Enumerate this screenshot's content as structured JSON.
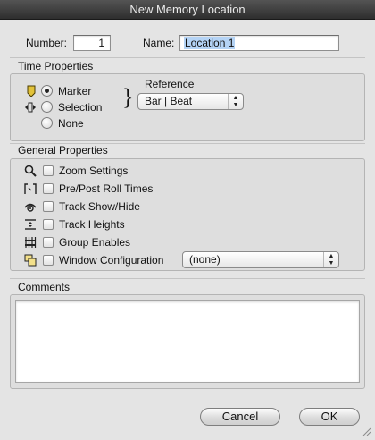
{
  "window": {
    "title": "New Memory Location"
  },
  "header": {
    "number_label": "Number:",
    "number_value": "1",
    "name_label": "Name:",
    "name_value": "Location 1"
  },
  "time_properties": {
    "title": "Time Properties",
    "options": [
      {
        "label": "Marker",
        "selected": true,
        "icon": "marker-icon"
      },
      {
        "label": "Selection",
        "selected": false,
        "icon": "selection-icon"
      },
      {
        "label": "None",
        "selected": false
      }
    ],
    "reference_label": "Reference",
    "brace": "}",
    "reference_value": "Bar | Beat"
  },
  "general_properties": {
    "title": "General Properties",
    "items": [
      {
        "label": "Zoom Settings",
        "checked": false,
        "icon": "magnifier-icon"
      },
      {
        "label": "Pre/Post Roll Times",
        "checked": false,
        "icon": "preroll-icon"
      },
      {
        "label": "Track Show/Hide",
        "checked": false,
        "icon": "eye-icon"
      },
      {
        "label": "Track Heights",
        "checked": false,
        "icon": "track-heights-icon"
      },
      {
        "label": "Group Enables",
        "checked": false,
        "icon": "group-enables-icon"
      },
      {
        "label": "Window Configuration",
        "checked": false,
        "icon": "window-config-icon"
      }
    ],
    "window_config_value": "(none)"
  },
  "comments": {
    "title": "Comments",
    "value": ""
  },
  "buttons": {
    "cancel": "Cancel",
    "ok": "OK"
  },
  "colors": {
    "marker_icon": "#e2c23a",
    "title_bar": "#3a3a3a"
  }
}
